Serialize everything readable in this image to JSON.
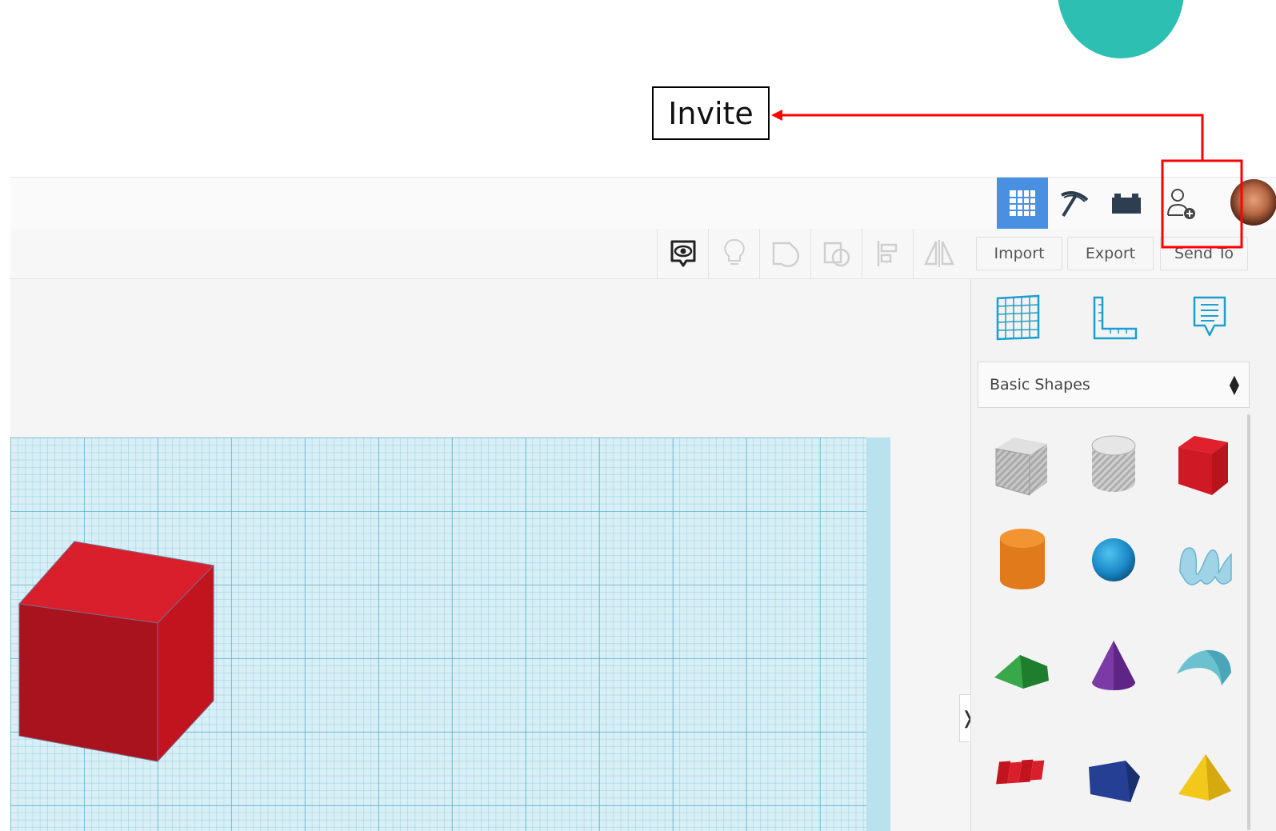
{
  "callout": {
    "label": "Invite"
  },
  "colors": {
    "active_tab": "#4a90e2",
    "annotation": "#ff0000",
    "brand_accent": "#2ebfb3",
    "workplane_grid": "#d8eff6"
  },
  "topbar": {
    "buttons": [
      {
        "icon": "grid-view-icon",
        "active": true
      },
      {
        "icon": "pickaxe-icon",
        "active": false
      },
      {
        "icon": "bricks-icon",
        "active": false
      },
      {
        "icon": "invite-person-icon",
        "active": false
      }
    ],
    "avatar": "user-avatar"
  },
  "toolbar": {
    "icons": [
      "show-all-icon",
      "lightbulb-icon",
      "group-icon",
      "ungroup-icon",
      "align-icon",
      "mirror-icon"
    ],
    "import_label": "Import",
    "export_label": "Export",
    "send_to_label": "Send To"
  },
  "right_panel": {
    "tool_icons": [
      "workplane-icon",
      "ruler-icon",
      "notes-icon"
    ],
    "shape_category": "Basic Shapes",
    "toggle_glyph": "❭",
    "shapes": [
      "box-hole",
      "cylinder-hole",
      "box",
      "cylinder",
      "sphere",
      "scribble",
      "roof",
      "cone",
      "round-roof",
      "text",
      "polygon",
      "pyramid"
    ]
  }
}
